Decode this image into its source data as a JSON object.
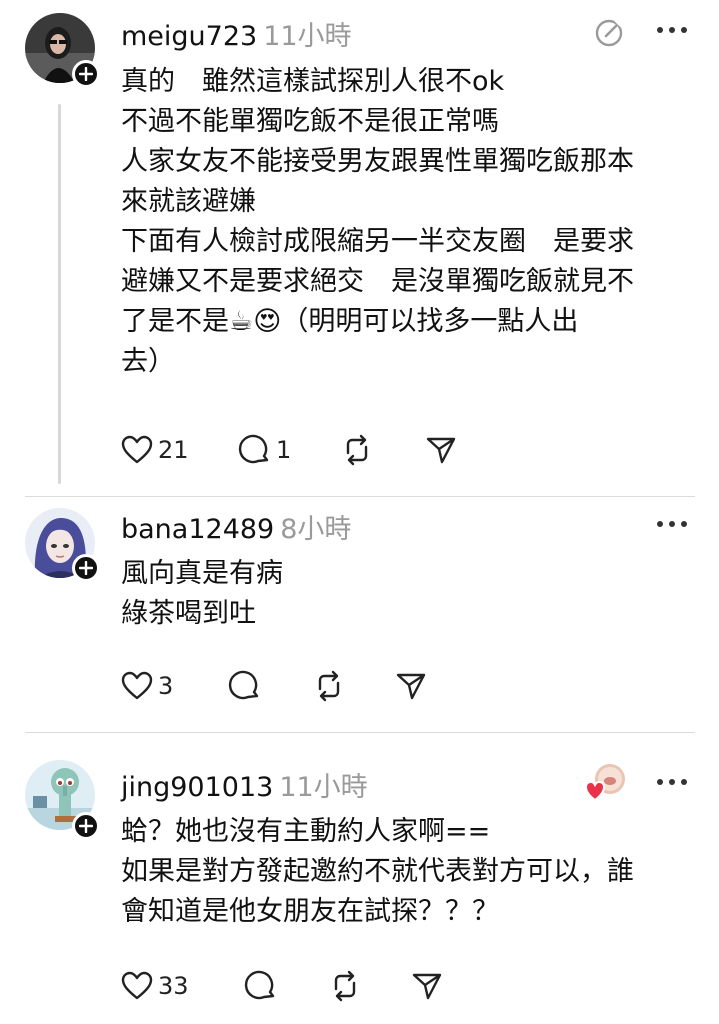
{
  "posts": [
    {
      "username": "meigu723",
      "time": "11小時",
      "lines": [
        "真的　雖然這樣試探別人很不ok",
        "不過不能單獨吃飯不是很正常嗎",
        "人家女友不能接受男友跟異性單獨吃飯那本",
        "來就該避嫌",
        "下面有人檢討成限縮另一半交友圈　是要求",
        "避嫌又不是要求絕交　是沒單獨吃飯就見不",
        "了是不是☕😍（明明可以找多一點人出",
        "去）"
      ],
      "likes": "21",
      "replies": "1",
      "icons": [
        "avatar-girl",
        "plus-icon",
        "edit-icon",
        "more-icon",
        "heart-icon",
        "comment-icon",
        "repost-icon",
        "share-icon"
      ]
    },
    {
      "username": "bana12489",
      "time": "8小時",
      "lines": [
        "風向真是有病",
        "綠茶喝到吐"
      ],
      "likes": "3",
      "replies": "",
      "icons": [
        "avatar-anime",
        "plus-icon",
        "more-icon",
        "heart-icon",
        "comment-icon",
        "repost-icon",
        "share-icon"
      ]
    },
    {
      "username": "jing901013",
      "time": "11小時",
      "lines": [
        "蛤？她也沒有主動約人家啊==",
        "如果是對方發起邀約不就代表對方可以，誰",
        "會知道是他女朋友在試探？？？"
      ],
      "likes": "33",
      "replies": "",
      "icons": [
        "avatar-squidward",
        "plus-icon",
        "liked-by-avatar",
        "more-icon",
        "heart-icon",
        "comment-icon",
        "repost-icon",
        "share-icon"
      ]
    }
  ],
  "colors": {
    "text": "#111111",
    "muted": "#9a9a9a",
    "divider": "#dcdcdc",
    "like-red": "#e8334a"
  }
}
